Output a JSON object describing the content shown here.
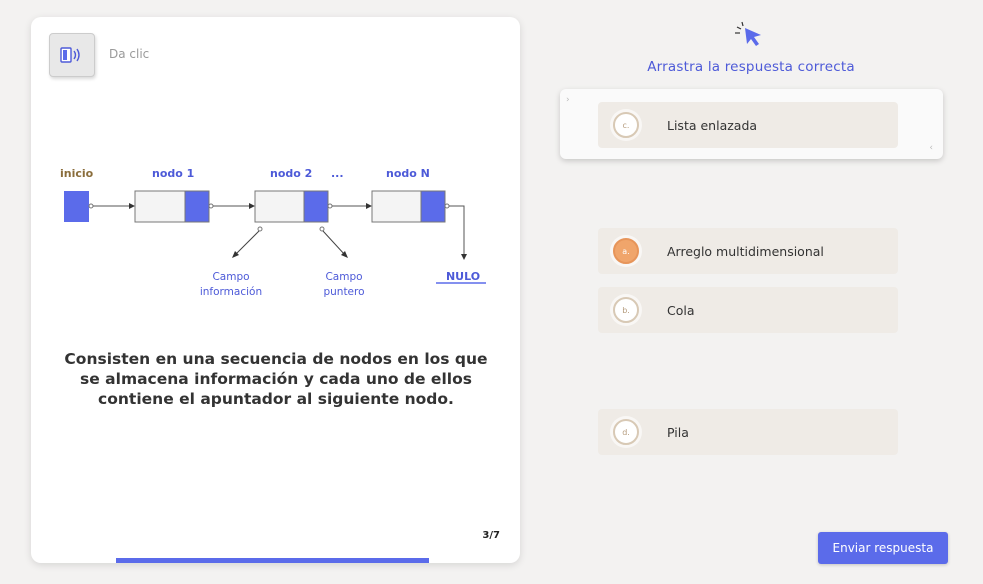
{
  "audio": {
    "label": "Da clic"
  },
  "diagram": {
    "labels": {
      "start": "inicio",
      "node1": "nodo 1",
      "node2": "nodo 2",
      "ellipsis": "...",
      "nodeN": "nodo N",
      "info_field_line1": "Campo",
      "info_field_line2": "información",
      "pointer_field_line1": "Campo",
      "pointer_field_line2": "puntero",
      "null": "NULO"
    }
  },
  "question": "Consisten en una secuencia de nodos en los que se almacena información y cada uno de ellos contiene el apuntador al siguiente nodo.",
  "page": "3/7",
  "progress_fraction": 0.43,
  "drag_title": "Arrastra la respuesta correcta",
  "dropped_option": {
    "letter": "c.",
    "label": "Lista enlazada"
  },
  "options": [
    {
      "letter": "a.",
      "label": "Arreglo multidimensional",
      "active": true
    },
    {
      "letter": "b.",
      "label": "Cola",
      "active": false
    },
    {
      "letter": "d.",
      "label": "Pila",
      "active": false
    }
  ],
  "submit_label": "Enviar respuesta",
  "colors": {
    "accent": "#5b6bea",
    "start_label": "#8a6d3b",
    "option_bg": "#efebe6",
    "active_badge": "#f0a56b"
  },
  "icons": [
    "speaker-icon",
    "cursor-click-icon"
  ]
}
